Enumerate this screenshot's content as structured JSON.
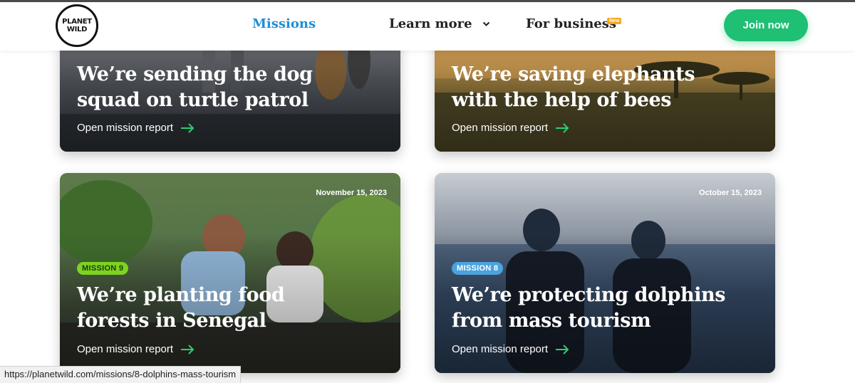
{
  "brand": {
    "logo_line1": "PLANET",
    "logo_line2": "WILD"
  },
  "nav": {
    "missions": "Missions",
    "learn_more": "Learn more",
    "for_business": "For business",
    "new_badge": "New",
    "join_button": "Join now"
  },
  "colors": {
    "accent_green": "#1fbf74",
    "link_blue": "#1f8fd6",
    "tag_green": "#7ed321",
    "tag_blue": "#4aa3df"
  },
  "cards": [
    {
      "title_line1": "We’re sending the dog",
      "title_line2": "squad on turtle patrol",
      "link": "Open mission report"
    },
    {
      "title_line1": "We’re saving elephants",
      "title_line2": "with the help of bees",
      "link": "Open mission report"
    },
    {
      "date": "November 15, 2023",
      "tag": "MISSION 9",
      "title_line1": "We’re planting food",
      "title_line2": "forests in Senegal",
      "link": "Open mission report"
    },
    {
      "date": "October 15, 2023",
      "tag": "MISSION 8",
      "title_line1": "We’re protecting dolphins",
      "title_line2": "from mass tourism",
      "link": "Open mission report"
    }
  ],
  "status_url": "https://planetwild.com/missions/8-dolphins-mass-tourism"
}
